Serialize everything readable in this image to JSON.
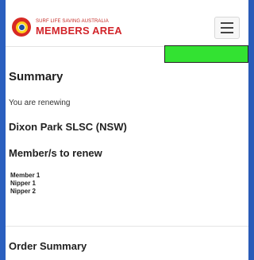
{
  "header": {
    "brand_small": "SURF LIFE SAVING AUSTRALIA",
    "brand_large": "MEMBERS AREA",
    "logo_icon": "slsa-logo-icon",
    "menu_icon": "hamburger-menu-icon"
  },
  "colors": {
    "brand_red": "#d2242a",
    "frame_blue": "#2a5fbf",
    "highlight_green": "#33e232"
  },
  "summary": {
    "title": "Summary",
    "renewing_text": "You are renewing",
    "club_name": "Dixon Park SLSC (NSW)",
    "members_heading": "Member/s to renew",
    "members": [
      "Member 1",
      "Nipper 1",
      "Nipper 2"
    ],
    "order_summary_heading": "Order Summary"
  }
}
